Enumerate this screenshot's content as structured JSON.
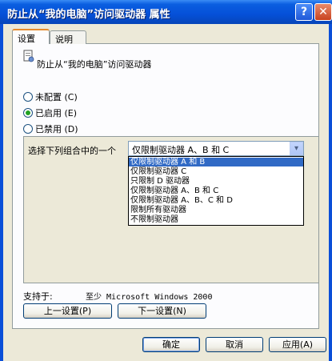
{
  "window": {
    "title": "防止从“我的电脑”访问驱动器 属性",
    "help_glyph": "?",
    "close_glyph": "✕"
  },
  "tabs": [
    {
      "label": "设置"
    },
    {
      "label": "说明"
    }
  ],
  "policy": {
    "title": "防止从“我的电脑”访问驱动器"
  },
  "radios": [
    {
      "label": "未配置 (C)",
      "checked": false
    },
    {
      "label": "已启用 (E)",
      "checked": true
    },
    {
      "label": "已禁用 (D)",
      "checked": false
    }
  ],
  "combo": {
    "label": "选择下列组合中的一个",
    "value": "仅限制驱动器 A、B 和 C",
    "arrow": "▾",
    "options": [
      "仅限制驱动器 A 和 B",
      "仅限制驱动器 C",
      "只限制 D 驱动器",
      "仅限制驱动器 A、B 和 C",
      "仅限制驱动器 A、B、C 和 D",
      "限制所有驱动器",
      "不限制驱动器"
    ],
    "highlighted_index": 0
  },
  "supported": {
    "label": "支持于:",
    "value": "至少 Microsoft Windows 2000"
  },
  "nav": {
    "prev_label": "上一设置(P)",
    "next_label": "下一设置(N)"
  },
  "footer": {
    "ok_label": "确定",
    "cancel_label": "取消",
    "apply_label": "应用(A)"
  },
  "colors": {
    "titlebar": "#0550d8",
    "selection": "#316ac5",
    "face": "#ece9d8"
  }
}
